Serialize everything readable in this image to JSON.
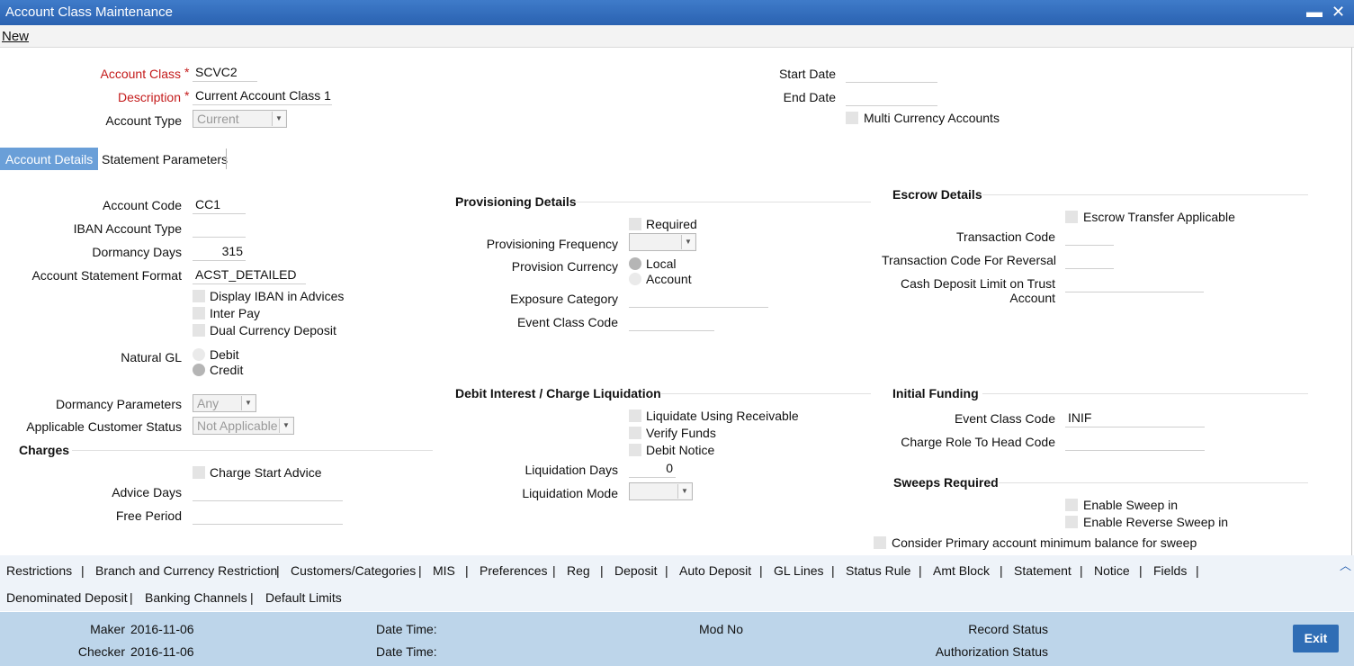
{
  "window": {
    "title": "Account Class Maintenance",
    "minimize": "▬",
    "close": "✕"
  },
  "menu": {
    "new": "New"
  },
  "header": {
    "account_class_label": "Account Class",
    "account_class_value": "SCVC2",
    "description_label": "Description",
    "description_value": "Current Account Class 1",
    "account_type_label": "Account Type",
    "account_type_value": "Current",
    "start_date_label": "Start Date",
    "end_date_label": "End Date",
    "multi_currency_label": "Multi Currency Accounts",
    "required_marker": "*"
  },
  "tabs": [
    "Account Details",
    "Statement Parameters"
  ],
  "account": {
    "account_code_label": "Account Code",
    "account_code_value": "CC1",
    "iban_type_label": "IBAN Account Type",
    "dormancy_days_label": "Dormancy Days",
    "dormancy_days_value": "315",
    "stmt_format_label": "Account Statement Format",
    "stmt_format_value": "ACST_DETAILED",
    "display_iban": "Display IBAN in Advices",
    "inter_pay": "Inter Pay",
    "dual_currency": "Dual Currency Deposit",
    "natural_gl_label": "Natural GL",
    "debit": "Debit",
    "credit": "Credit",
    "dormancy_params_label": "Dormancy Parameters",
    "dormancy_params_value": "Any",
    "cust_status_label": "Applicable Customer Status",
    "cust_status_value": "Not Applicable"
  },
  "charges": {
    "title": "Charges",
    "charge_start_advice": "Charge Start Advice",
    "advice_days_label": "Advice Days",
    "free_period_label": "Free Period"
  },
  "provisioning": {
    "title": "Provisioning Details",
    "required": "Required",
    "frequency_label": "Provisioning Frequency",
    "currency_label": "Provision Currency",
    "local": "Local",
    "account": "Account",
    "exposure_label": "Exposure Category",
    "event_class_label": "Event Class Code"
  },
  "escrow": {
    "title": "Escrow Details",
    "transfer_applicable": "Escrow Transfer Applicable",
    "txn_code_label": "Transaction Code",
    "txn_code_reversal_label": "Transaction Code For Reversal",
    "cash_deposit_label_1": "Cash Deposit Limit on Trust",
    "cash_deposit_label_2": "Account"
  },
  "liquidation": {
    "title": "Debit Interest / Charge Liquidation",
    "liquidate_receivable": "Liquidate Using Receivable",
    "verify_funds": "Verify Funds",
    "debit_notice": "Debit Notice",
    "days_label": "Liquidation Days",
    "days_value": "0",
    "mode_label": "Liquidation Mode"
  },
  "funding": {
    "title": "Initial Funding",
    "event_class_label": "Event Class Code",
    "event_class_value": "INIF",
    "charge_role_label": "Charge Role To Head Code"
  },
  "sweeps": {
    "title": "Sweeps Required",
    "enable_sweep_in": "Enable Sweep in",
    "enable_reverse_sweep": "Enable Reverse Sweep in",
    "consider_primary": "Consider Primary account minimum balance for sweep"
  },
  "links_row1": [
    "Restrictions",
    "|",
    "Branch and Currency Restriction",
    "|",
    "Customers/Categories",
    "|",
    "MIS",
    "|",
    "Preferences",
    "|",
    "Reg",
    "|",
    "Deposit",
    "|",
    "Auto Deposit",
    "|",
    "GL Lines",
    "|",
    "Status Rule",
    "|",
    "Amt Block",
    "|",
    "Statement",
    "|",
    "Notice",
    "|",
    "Fields",
    "|"
  ],
  "links_row2": [
    "Denominated Deposit",
    "|",
    "Banking Channels",
    "|",
    "Default Limits"
  ],
  "footer": {
    "maker_label": "Maker",
    "maker_value": "2016-11-06",
    "checker_label": "Checker",
    "checker_value": "2016-11-06",
    "date_time_label": "Date Time:",
    "mod_no_label": "Mod No",
    "record_status_label": "Record Status",
    "auth_status_label": "Authorization Status",
    "exit": "Exit"
  },
  "scroll_up_icon": "︿",
  "colors": {
    "titlebar": "#3569b8",
    "active_tab": "#6a9fd8",
    "footer": "#bdd5ea",
    "required": "#c41b1b",
    "exit_button": "#2f6db5"
  }
}
